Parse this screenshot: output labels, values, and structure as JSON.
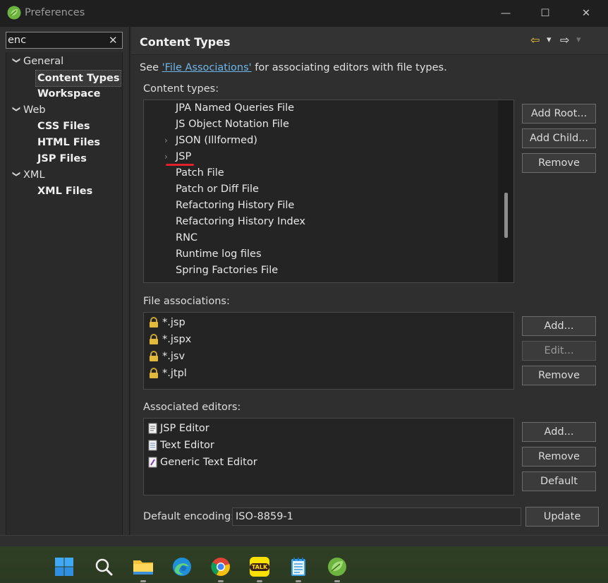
{
  "window": {
    "title": "Preferences",
    "minimize_glyph": "—",
    "maximize_glyph": "☐",
    "close_glyph": "✕"
  },
  "search": {
    "value": "enc",
    "clear_glyph": "✕"
  },
  "tree": {
    "groups": [
      {
        "label": "General",
        "children": [
          "Content Types",
          "Workspace"
        ]
      },
      {
        "label": "Web",
        "children": [
          "CSS Files",
          "HTML Files",
          "JSP Files"
        ]
      },
      {
        "label": "XML",
        "children": [
          "XML Files"
        ]
      }
    ],
    "expanded_glyph": "❯",
    "selected": "Content Types"
  },
  "page": {
    "title": "Content Types",
    "see_prefix": "See ",
    "see_link": "'File Associations'",
    "see_suffix": " for associating editors with file types.",
    "nav_back": "⇦",
    "nav_forward": "⇨",
    "nav_dropdown": "▾"
  },
  "content_types": {
    "label": "Content types:",
    "items": [
      {
        "label": "JPA Named Queries File",
        "expandable": false
      },
      {
        "label": "JS Object Notation File",
        "expandable": false
      },
      {
        "label": "JSON (Illformed)",
        "expandable": true
      },
      {
        "label": "JSP",
        "expandable": true
      },
      {
        "label": "Patch File",
        "expandable": false
      },
      {
        "label": "Patch or Diff File",
        "expandable": false
      },
      {
        "label": "Refactoring History File",
        "expandable": false
      },
      {
        "label": "Refactoring History Index",
        "expandable": false
      },
      {
        "label": "RNC",
        "expandable": false
      },
      {
        "label": "Runtime log files",
        "expandable": false
      },
      {
        "label": "Spring Factories File",
        "expandable": false
      }
    ],
    "expand_glyph": "›",
    "buttons": {
      "add_root": "Add Root...",
      "add_child": "Add Child...",
      "remove": "Remove"
    }
  },
  "file_associations": {
    "label": "File associations:",
    "items": [
      "*.jsp",
      "*.jspx",
      "*.jsv",
      "*.jtpl"
    ],
    "buttons": {
      "add": "Add...",
      "edit": "Edit...",
      "remove": "Remove"
    }
  },
  "associated_editors": {
    "label": "Associated editors:",
    "items": [
      "JSP Editor",
      "Text Editor",
      "Generic Text Editor"
    ],
    "buttons": {
      "add": "Add...",
      "remove": "Remove",
      "default": "Default"
    }
  },
  "encoding": {
    "label": "Default encoding:",
    "value": "ISO-8859-1",
    "update_label": "Update"
  },
  "taskbar": {
    "items": [
      "windows-start",
      "search",
      "file-explorer",
      "edge",
      "chrome",
      "kakaotalk",
      "notepad",
      "spring-tool-suite"
    ],
    "kakao_text": "TALK"
  },
  "colors": {
    "accent_link": "#6eb7e8",
    "annotation_underline": "#e0202a",
    "spring_green": "#6db33f"
  }
}
